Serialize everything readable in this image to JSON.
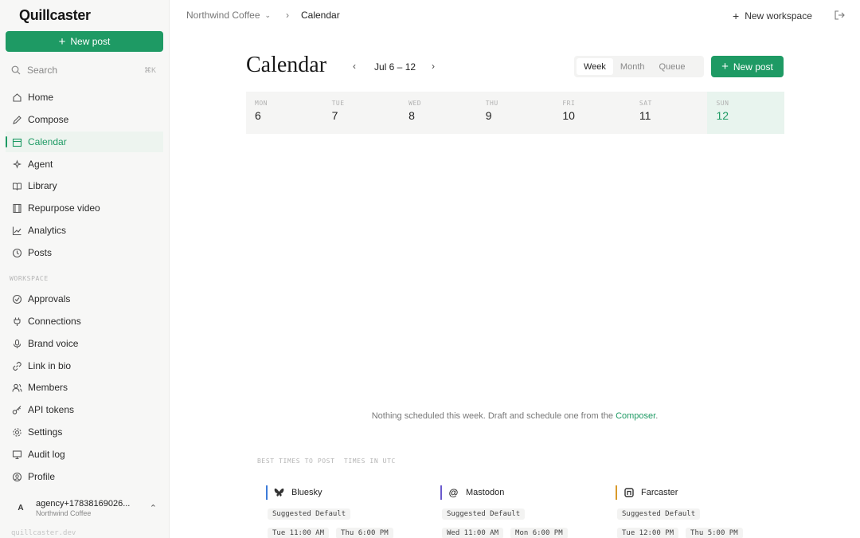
{
  "app": {
    "name": "Quillcaster",
    "footer": "quillcaster.dev"
  },
  "sidebar": {
    "new_post": "New post",
    "search": {
      "label": "Search",
      "shortcut": "⌘K"
    },
    "items": [
      {
        "label": "Home",
        "icon": "home-icon"
      },
      {
        "label": "Compose",
        "icon": "pen-icon"
      },
      {
        "label": "Calendar",
        "icon": "calendar-icon",
        "active": true
      },
      {
        "label": "Agent",
        "icon": "agent-icon"
      },
      {
        "label": "Library",
        "icon": "book-icon"
      },
      {
        "label": "Repurpose video",
        "icon": "film-icon"
      },
      {
        "label": "Analytics",
        "icon": "chart-icon"
      },
      {
        "label": "Posts",
        "icon": "clock-icon"
      }
    ],
    "workspace_label": "WORKSPACE",
    "workspace_items": [
      {
        "label": "Approvals",
        "icon": "check-circle-icon"
      },
      {
        "label": "Connections",
        "icon": "plug-icon"
      },
      {
        "label": "Brand voice",
        "icon": "mic-icon"
      },
      {
        "label": "Link in bio",
        "icon": "link-icon"
      },
      {
        "label": "Members",
        "icon": "users-icon"
      },
      {
        "label": "API tokens",
        "icon": "key-icon"
      },
      {
        "label": "Settings",
        "icon": "gear-icon"
      },
      {
        "label": "Audit log",
        "icon": "monitor-icon"
      },
      {
        "label": "Profile",
        "icon": "user-circle-icon"
      }
    ],
    "account": {
      "initial": "A",
      "email": "agency+17838169026...",
      "workspace": "Northwind Coffee"
    }
  },
  "topbar": {
    "workspace": "Northwind Coffee",
    "page": "Calendar",
    "new_workspace": "New workspace"
  },
  "header": {
    "title": "Calendar",
    "range": "Jul 6 – 12",
    "views": [
      "Week",
      "Month",
      "Queue"
    ],
    "active_view": "Week",
    "new_post": "New post"
  },
  "week": [
    {
      "name": "MON",
      "date": "6"
    },
    {
      "name": "TUE",
      "date": "7"
    },
    {
      "name": "WED",
      "date": "8"
    },
    {
      "name": "THU",
      "date": "9"
    },
    {
      "name": "FRI",
      "date": "10"
    },
    {
      "name": "SAT",
      "date": "11"
    },
    {
      "name": "SUN",
      "date": "12",
      "today": true
    }
  ],
  "empty": {
    "text": "Nothing scheduled this week. Draft and schedule one from the ",
    "link": "Composer",
    "end": "."
  },
  "best_times": {
    "label": "BEST TIMES TO POST",
    "tz": "TIMES IN UTC",
    "networks": [
      {
        "name": "Bluesky",
        "color": "#3d7bd9",
        "icon": "butterfly-icon",
        "suggested": "Suggested Default",
        "times": [
          "Tue 11:00 AM",
          "Thu 6:00 PM"
        ]
      },
      {
        "name": "Mastodon",
        "color": "#6a5acd",
        "icon": "at-icon",
        "suggested": "Suggested Default",
        "times": [
          "Wed 11:00 AM",
          "Mon 6:00 PM"
        ]
      },
      {
        "name": "Farcaster",
        "color": "#d99a2b",
        "icon": "farcaster-icon",
        "suggested": "Suggested Default",
        "times": [
          "Tue 12:00 PM",
          "Thu 5:00 PM"
        ]
      }
    ]
  }
}
